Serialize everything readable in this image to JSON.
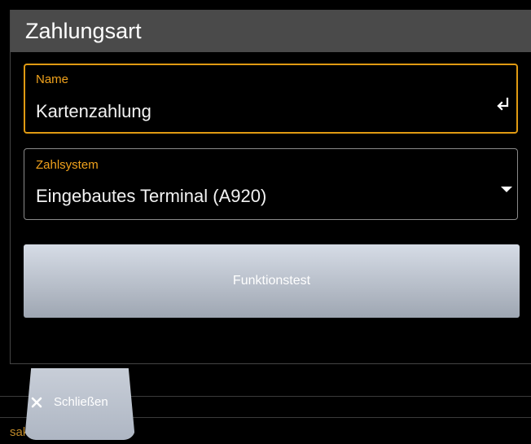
{
  "dialog": {
    "title": "Zahlungsart",
    "name_field": {
      "label": "Name",
      "value": "Kartenzahlung"
    },
    "system_field": {
      "label": "Zahlsystem",
      "value": "Eingebautes Terminal (A920)"
    },
    "test_button_label": "Funktionstest"
  },
  "close_tab": {
    "label": "Schließen"
  },
  "background": {
    "partial_text": "sak"
  },
  "colors": {
    "accent": "#f0a21c",
    "header": "#4a4a4a",
    "button": "#c3c9d3"
  }
}
